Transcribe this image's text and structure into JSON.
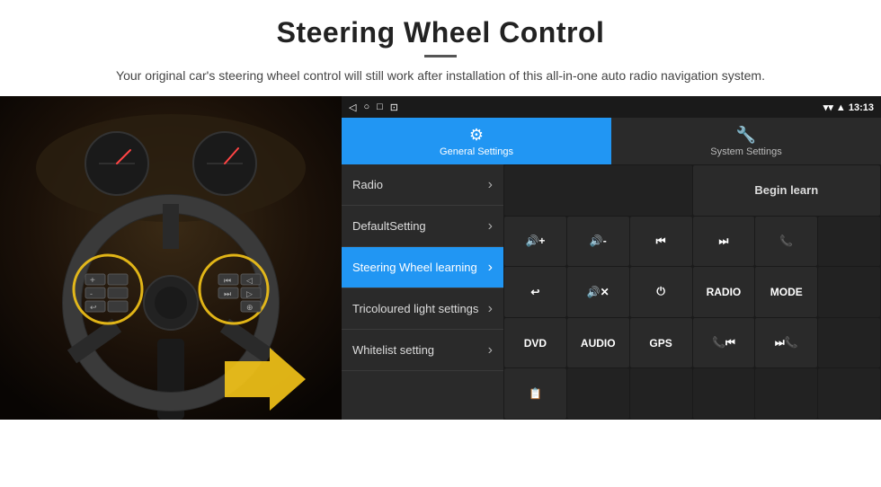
{
  "header": {
    "title": "Steering Wheel Control",
    "subtitle": "Your original car's steering wheel control will still work after installation of this all-in-one auto radio navigation system."
  },
  "status_bar": {
    "time": "13:13",
    "icons": [
      "back",
      "home",
      "recents",
      "cast"
    ]
  },
  "tabs": [
    {
      "id": "general",
      "label": "General Settings",
      "icon": "⚙",
      "active": true
    },
    {
      "id": "system",
      "label": "System Settings",
      "icon": "🔧",
      "active": false
    }
  ],
  "menu_items": [
    {
      "label": "Radio",
      "active": false
    },
    {
      "label": "DefaultSetting",
      "active": false
    },
    {
      "label": "Steering Wheel learning",
      "active": true
    },
    {
      "label": "Tricoloured light settings",
      "active": false
    },
    {
      "label": "Whitelist setting",
      "active": false
    }
  ],
  "controls": {
    "begin_learn": "Begin learn",
    "buttons": [
      {
        "label": "🔊+",
        "icon": "vol-up"
      },
      {
        "label": "🔊-",
        "icon": "vol-down"
      },
      {
        "label": "⏮",
        "icon": "prev"
      },
      {
        "label": "⏭",
        "icon": "next"
      },
      {
        "label": "📞",
        "icon": "call"
      },
      {
        "label": "↩",
        "icon": "hang-up"
      },
      {
        "label": "🔊✕",
        "icon": "mute"
      },
      {
        "label": "⏻",
        "icon": "power"
      },
      {
        "label": "RADIO",
        "icon": "radio"
      },
      {
        "label": "MODE",
        "icon": "mode"
      },
      {
        "label": "DVD",
        "icon": "dvd"
      },
      {
        "label": "AUDIO",
        "icon": "audio"
      },
      {
        "label": "GPS",
        "icon": "gps"
      },
      {
        "label": "📞⏮",
        "icon": "call-prev"
      },
      {
        "label": "⏭📞",
        "icon": "call-next"
      },
      {
        "label": "📋",
        "icon": "list"
      }
    ]
  }
}
